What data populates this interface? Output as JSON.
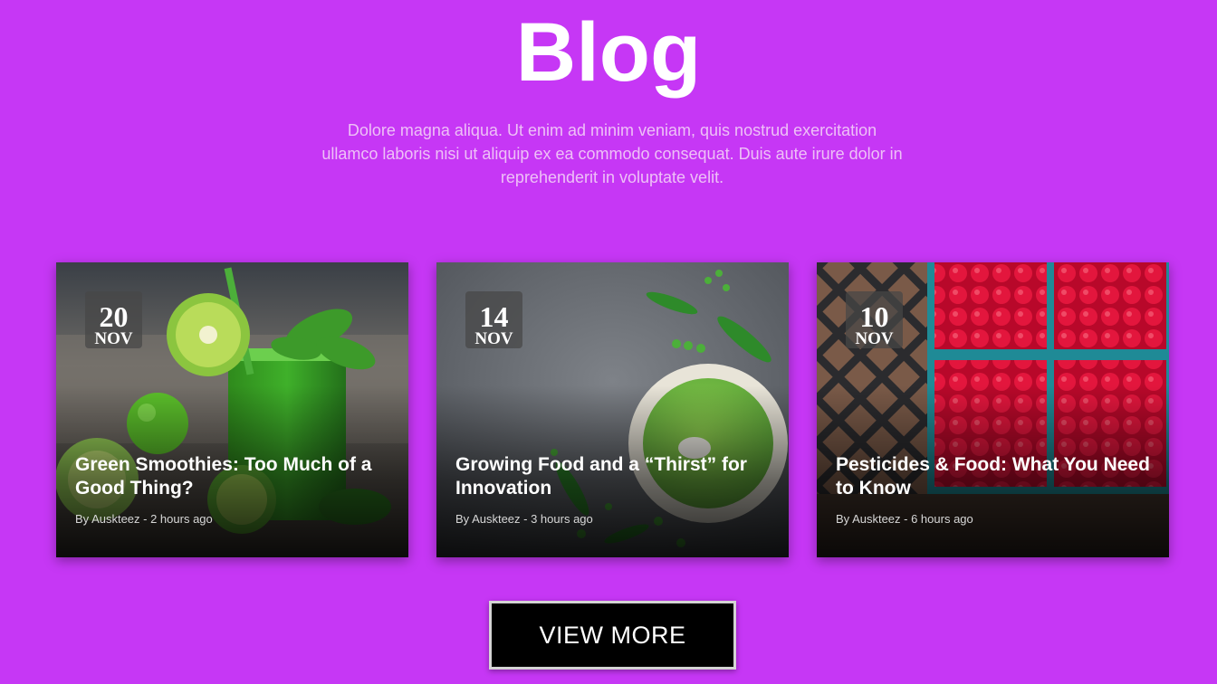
{
  "header": {
    "title": "Blog",
    "intro": "Dolore magna aliqua. Ut enim ad minim veniam, quis nostrud exercitation ullamco laboris nisi ut aliquip ex ea commodo consequat. Duis aute irure dolor in reprehenderit in voluptate velit."
  },
  "posts": [
    {
      "day": "20",
      "month": "NOV",
      "title": "Green Smoothies: Too Much of a Good Thing?",
      "meta": "By Auskteez - 2 hours ago",
      "image": "green-smoothie-kiwi-apple-photo"
    },
    {
      "day": "14",
      "month": "NOV",
      "title": "Growing Food and a “Thirst” for Innovation",
      "meta": "By Auskteez - 3 hours ago",
      "image": "pea-soup-bowl-photo"
    },
    {
      "day": "10",
      "month": "NOV",
      "title": "Pesticides & Food: What You Need to Know",
      "meta": "By Auskteez - 6 hours ago",
      "image": "raspberry-baskets-photo"
    }
  ],
  "actions": {
    "view_more": "VIEW MORE"
  },
  "colors": {
    "background": "#c637f5",
    "button": "#000000",
    "text": "#ffffff"
  }
}
